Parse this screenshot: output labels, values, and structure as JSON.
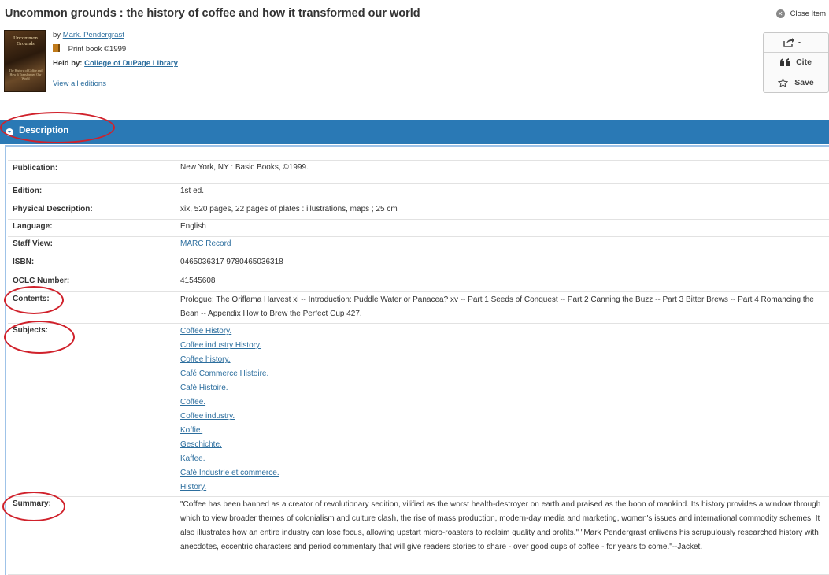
{
  "title": "Uncommon grounds : the history of coffee and how it transformed our world",
  "close_item": "Close Item",
  "cover": {
    "title_text": "Uncommon Grounds",
    "subtitle_text": "The History of Coffee and How It Transformed Our World"
  },
  "meta": {
    "by_prefix": "by",
    "author": "Mark. Pendergrast",
    "format": "Print book",
    "year": "©1999",
    "held_by_label": "Held by:",
    "held_by": "College of DuPage Library",
    "view_all": "View all editions"
  },
  "toolbar": {
    "share_icon": "share-icon",
    "cite_label": "Cite",
    "save_label": "Save"
  },
  "section": {
    "label": "Description"
  },
  "details": {
    "publication_label": "Publication:",
    "publication": "New York, NY : Basic Books, ©1999.",
    "edition_label": "Edition:",
    "edition": "1st ed.",
    "physical_label": "Physical Description:",
    "physical": "xix, 520 pages, 22 pages of plates : illustrations, maps ; 25 cm",
    "language_label": "Language:",
    "language": "English",
    "staff_label": "Staff View:",
    "staff": "MARC Record",
    "isbn_label": "ISBN:",
    "isbn": "0465036317 9780465036318",
    "oclc_label": "OCLC Number:",
    "oclc": "41545608",
    "contents_label": "Contents:",
    "contents": "Prologue: The Oriflama Harvest xi -- Introduction: Puddle Water or Panacea? xv -- Part 1 Seeds of Conquest -- Part 2 Canning the Buzz -- Part 3 Bitter Brews -- Part 4 Romancing the Bean -- Appendix How to Brew the Perfect Cup 427.",
    "subjects_label": "Subjects:",
    "subjects": [
      "Coffee History.",
      "Coffee industry History.",
      "Coffee history.",
      "Café Commerce Histoire.",
      "Café Histoire.",
      "Coffee.",
      "Coffee industry.",
      "Koffie.",
      "Geschichte.",
      "Kaffee.",
      "Café Industrie et commerce.",
      "History."
    ],
    "summary_label": "Summary:",
    "summary": "\"Coffee has been banned as a creator of revolutionary sedition, vilified as the worst health-destroyer on earth and praised as the boon of mankind. Its history provides a window through which to view broader themes of colonialism and culture clash, the rise of mass production, modern-day media and marketing, women's issues and international commodity schemes. It also illustrates how an entire industry can lose focus, allowing upstart micro-roasters to reclaim quality and profits.\" \"Mark Pendergrast enlivens his scrupulously researched history with anecdotes, eccentric characters and period commentary that will give readers stories to share - over good cups of coffee - for years to come.\"--Jacket."
  }
}
